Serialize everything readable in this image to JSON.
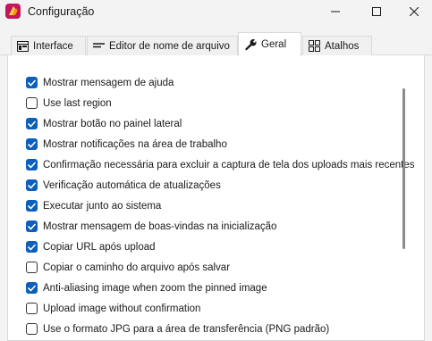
{
  "window": {
    "title": "Configuração",
    "app_icon": "app-logo-icon",
    "accent_color": "#0c5fba"
  },
  "tabs": [
    {
      "label": "Interface",
      "icon": "interface-icon",
      "active": false
    },
    {
      "label": "Editor de nome de arquivo",
      "icon": "editor-icon",
      "active": false
    },
    {
      "label": "Geral",
      "icon": "wrench-icon",
      "active": true
    },
    {
      "label": "Atalhos",
      "icon": "shortcuts-icon",
      "active": false
    }
  ],
  "options": [
    {
      "label": "Mostrar mensagem de ajuda",
      "checked": true
    },
    {
      "label": "Use last region",
      "checked": false
    },
    {
      "label": "Mostrar botão no painel lateral",
      "checked": true
    },
    {
      "label": "Mostrar notificações na área de trabalho",
      "checked": true
    },
    {
      "label": "Confirmação necessária para excluir a captura de tela dos uploads mais recentes",
      "checked": true
    },
    {
      "label": "Verificação automática de atualizações",
      "checked": true
    },
    {
      "label": "Executar junto ao sistema",
      "checked": true
    },
    {
      "label": "Mostrar mensagem de boas-vindas na inicialização",
      "checked": true
    },
    {
      "label": "Copiar URL após upload",
      "checked": true
    },
    {
      "label": "Copiar o caminho do arquivo após salvar",
      "checked": false
    },
    {
      "label": "Anti-aliasing image when zoom the pinned image",
      "checked": true
    },
    {
      "label": "Upload image without confirmation",
      "checked": false
    },
    {
      "label": "Use o formato JPG para a área de transferência (PNG padrão)",
      "checked": false
    }
  ]
}
